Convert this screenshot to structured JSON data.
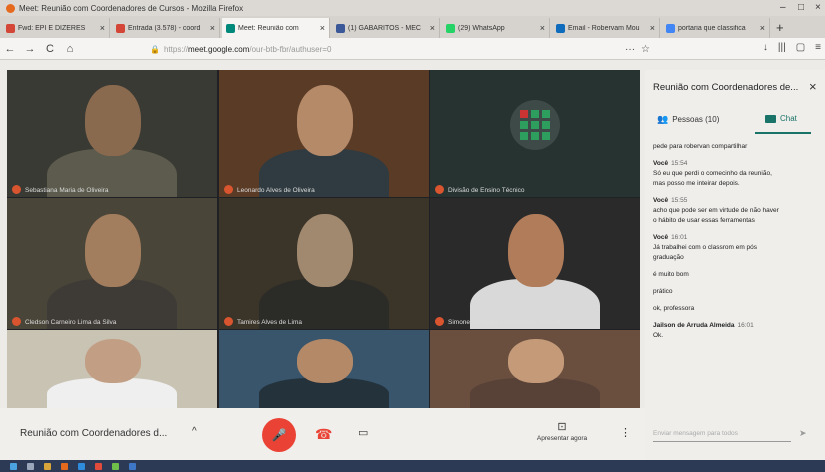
{
  "window": {
    "title": "Meet: Reunião com Coordenadores de Cursos - Mozilla Firefox",
    "controls": [
      "–",
      "□",
      "×"
    ]
  },
  "tabs": [
    {
      "label": "Fwd: EPI E DIZERES",
      "color": "#d44638",
      "active": false
    },
    {
      "label": "Entrada (3.578) - coord",
      "color": "#d44638",
      "active": false
    },
    {
      "label": "Meet: Reunião com",
      "color": "#00897b",
      "active": true
    },
    {
      "label": "(1) GABARITOS - MEC",
      "color": "#3b5998",
      "active": false
    },
    {
      "label": "(29) WhatsApp",
      "color": "#25d366",
      "active": false
    },
    {
      "label": "Email - Robervam Mou",
      "color": "#0f6cbd",
      "active": false
    },
    {
      "label": "portaria que classifica",
      "color": "#4285f4",
      "active": false
    }
  ],
  "nav": {
    "back": "←",
    "forward": "→",
    "reload": "C",
    "home": "⌂",
    "url_prefix": "https://",
    "url_host": "meet.google.com",
    "url_path": "/our-btb-fbr/authuser=0",
    "menu": "···",
    "right_icons": [
      "↓",
      "|||",
      "▢",
      "≡"
    ]
  },
  "tiles": [
    {
      "name": "Sebastiana Maria de Oliveira",
      "bg": "#3a3a34",
      "skin": "#8a6a4f",
      "shirt": "#5c5b4d"
    },
    {
      "name": "Leonardo Alves de Oliveira",
      "bg": "#5a3b26",
      "skin": "#b58a69",
      "shirt": "#2f3b40"
    },
    {
      "name": "Divisão de Ensino Técnico",
      "bg": "#263331",
      "skin": "",
      "shirt": ""
    },
    {
      "name": "Cledson Carneiro Lima da Silva",
      "bg": "#4a4539",
      "skin": "#a27d5e",
      "shirt": "#3e3a36"
    },
    {
      "name": "Tamires Alves de Lima",
      "bg": "#3b3429",
      "skin": "#a0896f",
      "shirt": "#2b2b28"
    },
    {
      "name": "Simone Santiago Sarmento de Oliveira",
      "bg": "#2a2a2b",
      "skin": "#b07c5a",
      "shirt": "#d9d9d9"
    },
    {
      "name": "",
      "bg": "#c9c3b4",
      "skin": "#c29f84",
      "shirt": "#efefef"
    },
    {
      "name": "",
      "bg": "#38556b",
      "skin": "#b48968",
      "shirt": "#24323c"
    },
    {
      "name": "",
      "bg": "#6a4f3f",
      "skin": "#c49a79",
      "shirt": "#584238"
    }
  ],
  "panel": {
    "title": "Reunião com Coordenadores de...",
    "close": "×",
    "tab_people": "Pessoas (10)",
    "tab_chat": "Chat",
    "messages": [
      {
        "sender": "",
        "time": "",
        "lines": [
          "pede para robervan compartilhar"
        ]
      },
      {
        "sender": "Você",
        "time": "15:54",
        "lines": [
          "Só eu que perdi o comecinho da reunião,",
          "mas posso me inteirar depois."
        ]
      },
      {
        "sender": "Você",
        "time": "15:55",
        "lines": [
          "acho que pode ser em virtude de não haver",
          "o hábito de usar essas ferramentas"
        ]
      },
      {
        "sender": "Você",
        "time": "16:01",
        "lines": [
          "Já trabalhei com o classrom em pós",
          "graduação"
        ]
      },
      {
        "sender": "",
        "time": "",
        "lines": [
          "é muito bom"
        ]
      },
      {
        "sender": "",
        "time": "",
        "lines": [
          "prático"
        ]
      },
      {
        "sender": "",
        "time": "",
        "lines": [
          "ok, professora"
        ]
      },
      {
        "sender": "Jailson de Arruda Almeida",
        "time": "16:01",
        "lines": [
          "Ok."
        ]
      }
    ],
    "input_placeholder": "Enviar mensagem para todos"
  },
  "bottom": {
    "meeting_name": "Reunião com Coordenadores d...",
    "chevron": "^",
    "present_label": "Apresentar agora",
    "more": "⋮"
  },
  "colors": {
    "accent": "#1a7368",
    "mic": "#ea4335",
    "avatar": "#d9552f"
  }
}
